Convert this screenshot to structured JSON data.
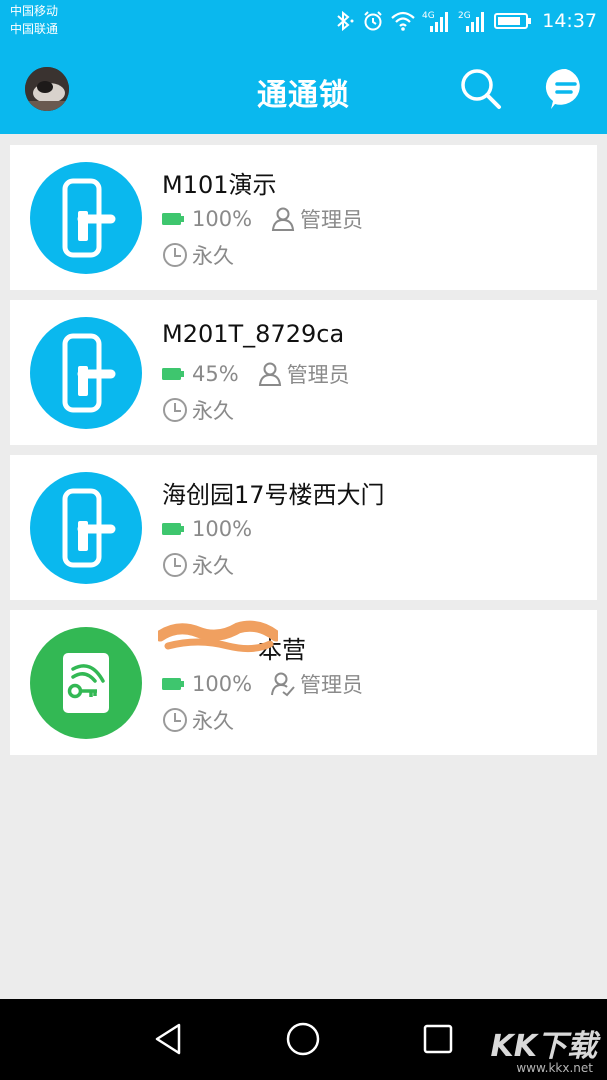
{
  "status_bar": {
    "carrier_1": "中国移动",
    "carrier_2": "中国联通",
    "net_1": "4G",
    "net_2": "2G",
    "time": "14:37"
  },
  "header": {
    "title": "通通锁",
    "icons": [
      "avatar",
      "search-icon",
      "message-icon"
    ]
  },
  "locks": [
    {
      "name": "M101演示",
      "battery": "100%",
      "role": "管理员",
      "validity": "永久",
      "icon_color": "#0ab8ee"
    },
    {
      "name": "M201T_8729ca",
      "battery": "45%",
      "role": "管理员",
      "validity": "永久",
      "icon_color": "#0ab8ee"
    },
    {
      "name": "海创园17号楼西大门",
      "battery": "100%",
      "role": "",
      "validity": "永久",
      "icon_color": "#0ab8ee"
    },
    {
      "name": "本营",
      "battery": "100%",
      "role": "管理员",
      "validity": "永久",
      "icon_color": "#33b854"
    }
  ],
  "watermark": {
    "text": "KK下载",
    "sub": "www.kkx.net"
  },
  "colors": {
    "accent": "#0ab8ee",
    "battery": "#3ec66e",
    "green_lock": "#33b854",
    "background": "#ececec"
  }
}
